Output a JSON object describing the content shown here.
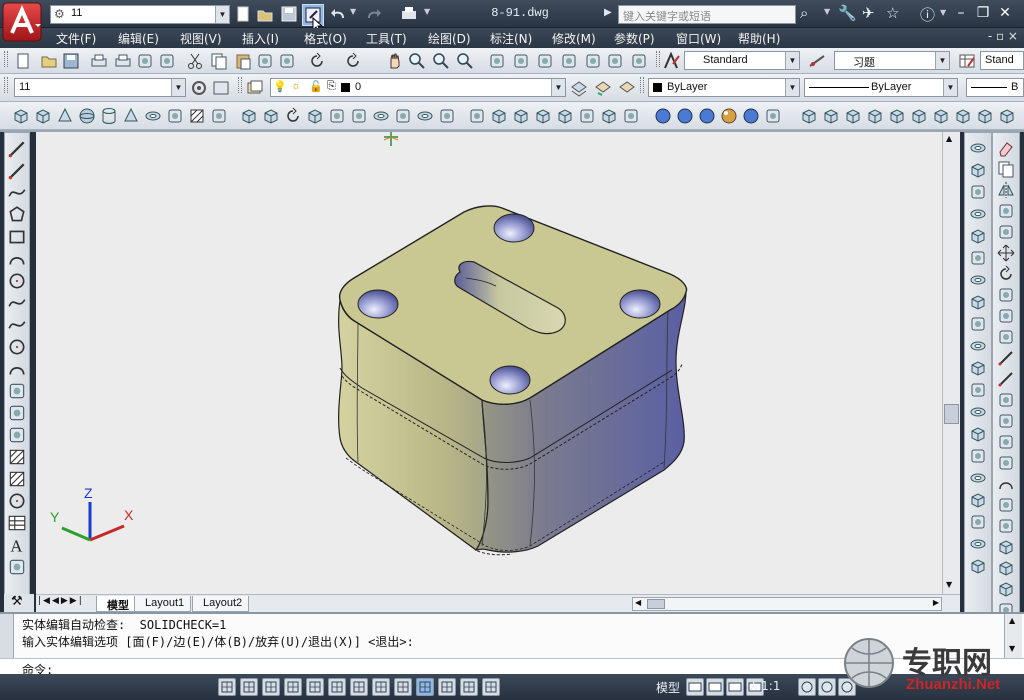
{
  "app": {
    "workspace_value": "11",
    "title": "8-91.dwg",
    "search_placeholder": "键入关键字或短语"
  },
  "menu": {
    "items": [
      "文件(F)",
      "编辑(E)",
      "视图(V)",
      "插入(I)",
      "格式(O)",
      "工具(T)",
      "绘图(D)",
      "标注(N)",
      "修改(M)",
      "参数(P)",
      "窗口(W)",
      "帮助(H)"
    ],
    "right_controls": "- ▫ ×"
  },
  "toolbar2": {
    "text_style": "Standard",
    "dim_style": "习题",
    "table_style": "Stand"
  },
  "toolbar3": {
    "workspace2": "11",
    "layer": "0",
    "color": "ByLayer",
    "linetype": "ByLayer",
    "lineweight": "B"
  },
  "drawing": {
    "ucs_x": "X",
    "ucs_y": "Y",
    "ucs_z": "Z"
  },
  "tabs": {
    "model": "模型",
    "layout1": "Layout1",
    "layout2": "Layout2"
  },
  "command": {
    "line1": "实体编辑自动检查:  SOLIDCHECK=1",
    "line2": "输入实体编辑选项 [面(F)/边(E)/体(B)/放弃(U)/退出(X)] <退出>:",
    "prompt": "命令:"
  },
  "status": {
    "model_label": "模型",
    "scale": "1:1",
    "watermark_cn": "专职网",
    "watermark_en": "Zhuanzhi.Net"
  },
  "colors": {
    "accent": "#c8282a",
    "solid_top": "#c9c892",
    "solid_shadow": "#5b5f9c"
  }
}
